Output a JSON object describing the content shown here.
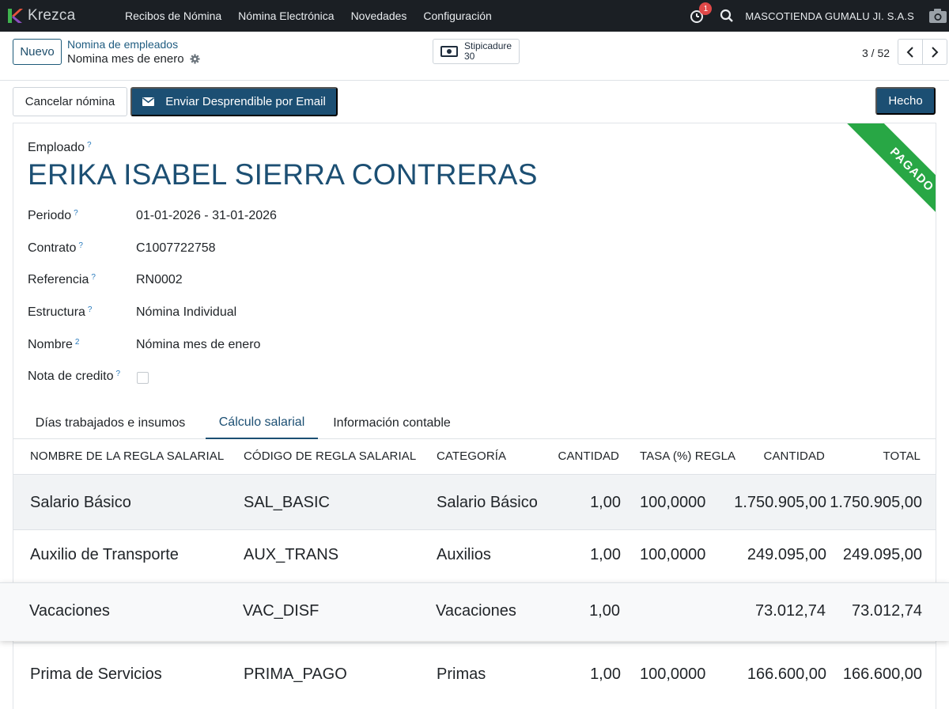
{
  "navbar": {
    "brand": "Krezca",
    "menu": [
      "Recibos de Nómina",
      "Nómina Electrónica",
      "Novedades",
      "Configuración"
    ],
    "notification_count": "1",
    "company": "MASCOTIENDA GUMALU JI. S.A.S"
  },
  "control_panel": {
    "new_button": "Nuevo",
    "breadcrumb_parent": "Nomina de empleados",
    "breadcrumb_current": "Nomina mes de enero",
    "smart_button": {
      "label": "Stipicadure",
      "value": "30"
    },
    "pager": "3 / 52"
  },
  "actions": {
    "cancel": "Cancelar nómina",
    "send_email": "Enviar Desprendible por Email",
    "done": "Hecho"
  },
  "ribbon": "PAGADO",
  "form": {
    "employee_label": "Emploado",
    "employee_name": "ERIKA ISABEL SIERRA CONTRERAS",
    "fields": [
      {
        "label": "Periodo",
        "help": "?",
        "value": "01-01-2026 - 31-01-2026"
      },
      {
        "label": "Contrato",
        "help": "?",
        "value": "C1007722758"
      },
      {
        "label": "Referencia",
        "help": "?",
        "value": "RN0002"
      },
      {
        "label": "Estructura",
        "help": "?",
        "value": "Nómina Individual"
      },
      {
        "label": "Nombre",
        "help": "2",
        "value": "Nómina mes de enero"
      },
      {
        "label": "Nota de credito",
        "help": "?",
        "value": ""
      }
    ]
  },
  "tabs": [
    "Días trabajados e insumos",
    "Cálculo salarial",
    "Información contable"
  ],
  "table": {
    "headers": [
      "NOMBRE DE LA REGLA SALARIAL",
      "CÓDIGO DE REGLA SALARIAL",
      "CATEGORÍA",
      "CANTIDAD",
      "TASA (%) REGLA",
      "CANTIDAD",
      "TOTAL"
    ],
    "rows": [
      [
        "Salario Básico",
        "SAL_BASIC",
        "Salario Básico",
        "1,00",
        "100,0000",
        "1.750.905,00",
        "1.750.905,00"
      ],
      [
        "Auxilio de Transporte",
        "AUX_TRANS",
        "Auxilios",
        "1,00",
        "100,0000",
        "249.095,00",
        "249.095,00"
      ],
      [
        "Vacaciones",
        "VAC_DISF",
        "Vacaciones",
        "1,00",
        "",
        "73.012,74",
        "73.012,74"
      ],
      [
        "Prima de Servicios",
        "PRIMA_PAGO",
        "Primas",
        "1,00",
        "100,0000",
        "166.600,00",
        "166.600,00"
      ]
    ]
  }
}
